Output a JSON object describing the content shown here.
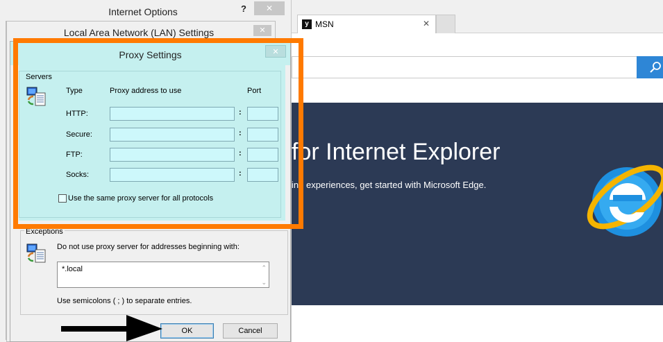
{
  "browser": {
    "tab_label": "MSN",
    "tab_close": "✕",
    "hero_title": "for Internet Explorer",
    "hero_subtitle": "ing experiences, get started with Microsoft Edge."
  },
  "internet_options": {
    "title": "Internet Options",
    "help": "?",
    "close": "✕"
  },
  "lan_settings": {
    "title": "Local Area Network (LAN) Settings",
    "close": "✕"
  },
  "proxy_settings": {
    "title": "Proxy Settings",
    "close": "✕",
    "servers": {
      "group_label": "Servers",
      "header_type": "Type",
      "header_address": "Proxy address to use",
      "header_port": "Port",
      "colon": ":",
      "rows": [
        {
          "label": "HTTP:",
          "address": "",
          "port": ""
        },
        {
          "label": "Secure:",
          "address": "",
          "port": ""
        },
        {
          "label": "FTP:",
          "address": "",
          "port": ""
        },
        {
          "label": "Socks:",
          "address": "",
          "port": ""
        }
      ],
      "same_proxy_label": "Use the same proxy server for all protocols",
      "same_proxy_checked": false
    },
    "exceptions": {
      "group_label": "Exceptions",
      "instruction": "Do not use proxy server for addresses beginning with:",
      "value": "*.local",
      "hint": "Use semicolons ( ; ) to separate entries."
    },
    "ok_label": "OK",
    "cancel_label": "Cancel"
  },
  "colors": {
    "highlight": "#ff7a00",
    "dialog_tint": "#c5f0ef",
    "hero_background": "#2c3a55",
    "search_button": "#2e86d6"
  }
}
